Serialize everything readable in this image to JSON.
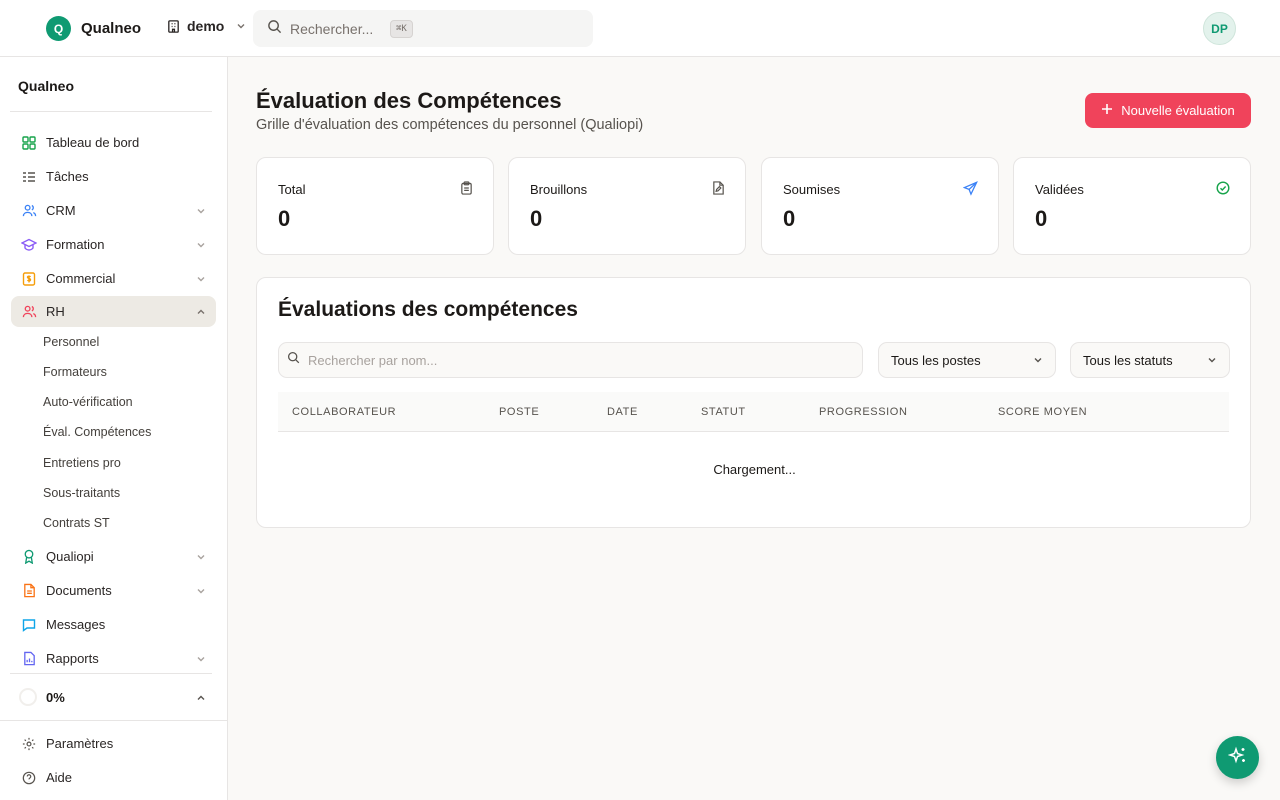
{
  "topbar": {
    "brand_initial": "Q",
    "brand_name": "Qualneo",
    "workspace": "demo",
    "search_placeholder": "Rechercher...",
    "search_shortcut": "⌘K",
    "avatar_initials": "DP"
  },
  "sidebar": {
    "title": "Qualneo",
    "items": [
      {
        "label": "Tableau de bord",
        "icon": "dashboard-icon",
        "color": "#16a34a"
      },
      {
        "label": "Tâches",
        "icon": "tasks-icon",
        "color": "#57534e"
      },
      {
        "label": "CRM",
        "icon": "users-icon",
        "color": "#3b82f6"
      },
      {
        "label": "Formation",
        "icon": "graduation-cap-icon",
        "color": "#8b5cf6"
      },
      {
        "label": "Commercial",
        "icon": "dollar-icon",
        "color": "#f59e0b"
      },
      {
        "label": "RH",
        "icon": "users-icon",
        "color": "#f0435b"
      },
      {
        "label": "Qualiopi",
        "icon": "award-icon",
        "color": "#0f9a72"
      },
      {
        "label": "Documents",
        "icon": "file-icon",
        "color": "#f97316"
      },
      {
        "label": "Messages",
        "icon": "message-icon",
        "color": "#0ea5e9"
      },
      {
        "label": "Rapports",
        "icon": "chart-icon",
        "color": "#6366f1"
      }
    ],
    "rh_subitems": [
      "Personnel",
      "Formateurs",
      "Auto-vérification",
      "Éval. Compétences",
      "Entretiens pro",
      "Sous-traitants",
      "Contrats ST"
    ],
    "progress": "0%",
    "footer": [
      {
        "label": "Paramètres",
        "icon": "gear-icon"
      },
      {
        "label": "Aide",
        "icon": "help-icon"
      }
    ]
  },
  "main": {
    "title": "Évaluation des Compétences",
    "subtitle": "Grille d'évaluation des compétences du personnel (Qualiopi)",
    "new_button": "Nouvelle évaluation",
    "stats": [
      {
        "label": "Total",
        "value": "0",
        "icon": "clipboard-icon",
        "color": "#57534e"
      },
      {
        "label": "Brouillons",
        "value": "0",
        "icon": "file-edit-icon",
        "color": "#57534e"
      },
      {
        "label": "Soumises",
        "value": "0",
        "icon": "send-icon",
        "color": "#3b82f6"
      },
      {
        "label": "Validées",
        "value": "0",
        "icon": "check-circle-icon",
        "color": "#16a34a"
      }
    ],
    "panel": {
      "title": "Évaluations des compétences",
      "search_placeholder": "Rechercher par nom...",
      "filter_poste": "Tous les postes",
      "filter_statut": "Tous les statuts",
      "columns": [
        "COLLABORATEUR",
        "POSTE",
        "DATE",
        "STATUT",
        "PROGRESSION",
        "SCORE MOYEN"
      ],
      "loading": "Chargement..."
    }
  }
}
